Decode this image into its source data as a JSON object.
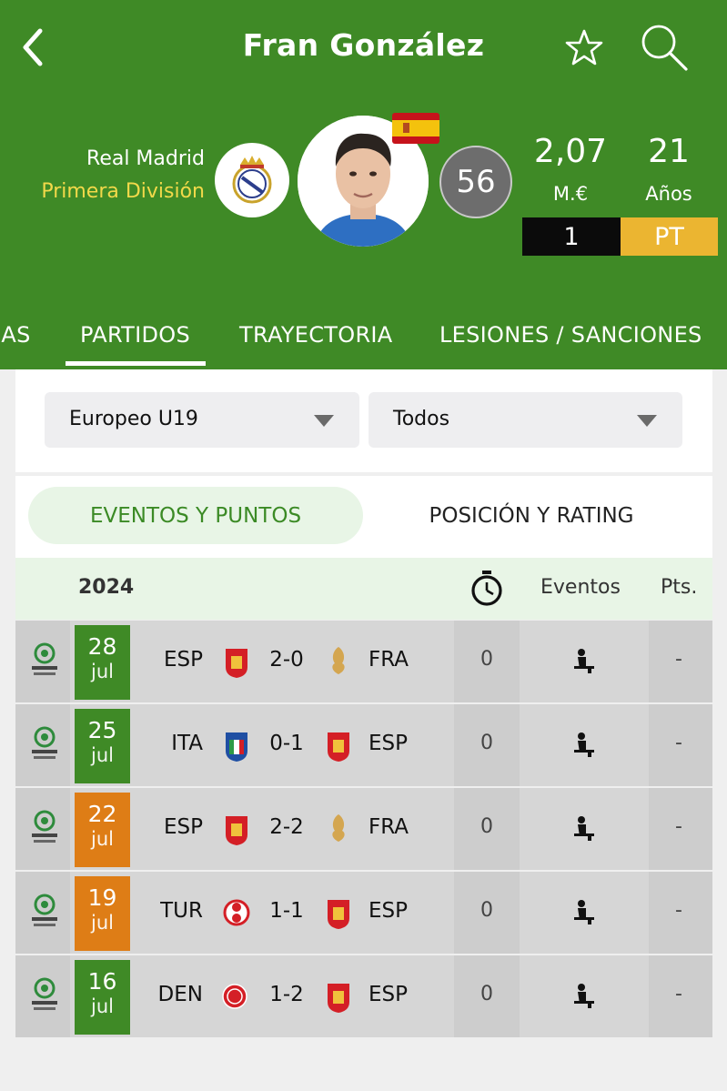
{
  "header": {
    "title": "Fran González",
    "team": "Real Madrid",
    "league": "Primera División",
    "rating": "56",
    "value": "2,07",
    "value_label": "M.€",
    "age": "21",
    "age_label": "Años",
    "shirt_number": "1",
    "position": "PT"
  },
  "tabs": [
    {
      "label": "IAS"
    },
    {
      "label": "PARTIDOS",
      "active": true
    },
    {
      "label": "TRAYECTORIA"
    },
    {
      "label": "LESIONES / SANCIONES"
    }
  ],
  "filters": {
    "competition": "Europeo U19",
    "type": "Todos"
  },
  "segments": {
    "active": "EVENTOS Y PUNTOS",
    "inactive": "POSICIÓN Y RATING"
  },
  "table": {
    "year": "2024",
    "events_header": "Eventos",
    "pts_header": "Pts.",
    "rows": [
      {
        "day": "28",
        "month": "jul",
        "date_color": "#3f8a26",
        "home": "ESP",
        "score": "2-0",
        "away": "FRA",
        "minutes": "0",
        "pts": "-"
      },
      {
        "day": "25",
        "month": "jul",
        "date_color": "#3f8a26",
        "home": "ITA",
        "score": "0-1",
        "away": "ESP",
        "minutes": "0",
        "pts": "-"
      },
      {
        "day": "22",
        "month": "jul",
        "date_color": "#de7d16",
        "home": "ESP",
        "score": "2-2",
        "away": "FRA",
        "minutes": "0",
        "pts": "-"
      },
      {
        "day": "19",
        "month": "jul",
        "date_color": "#de7d16",
        "home": "TUR",
        "score": "1-1",
        "away": "ESP",
        "minutes": "0",
        "pts": "-"
      },
      {
        "day": "16",
        "month": "jul",
        "date_color": "#3f8a26",
        "home": "DEN",
        "score": "1-2",
        "away": "ESP",
        "minutes": "0",
        "pts": "-"
      }
    ]
  },
  "colors": {
    "header_green": "#3f8a26",
    "league_yellow": "#f2d94a",
    "position_yellow": "#ebb531",
    "active_green": "#3b8a25"
  }
}
